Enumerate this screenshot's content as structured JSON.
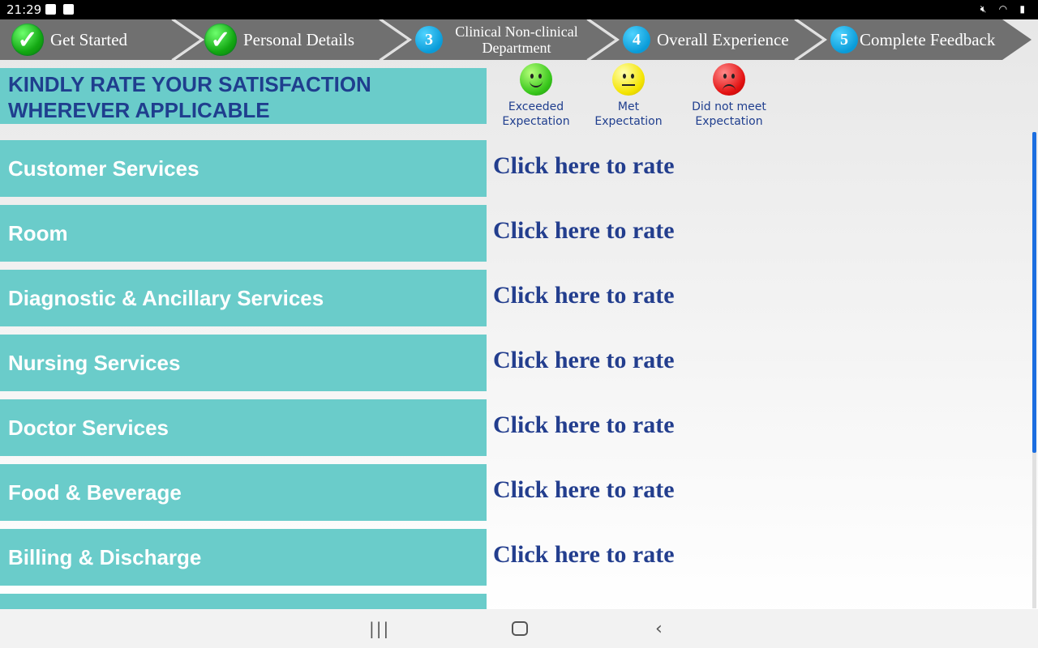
{
  "status_bar": {
    "time": "21:29",
    "right_icons": [
      "mute-icon",
      "wifi-icon",
      "battery-icon"
    ]
  },
  "steps": [
    {
      "marker": "check",
      "label": "Get Started",
      "completed": true
    },
    {
      "marker": "check",
      "label": "Personal Details",
      "completed": true
    },
    {
      "marker": "3",
      "label": "Clinical Non-clinical Department",
      "completed": false
    },
    {
      "marker": "4",
      "label": "Overall Experience",
      "completed": false
    },
    {
      "marker": "5",
      "label": "Complete Feedback",
      "completed": false
    }
  ],
  "instruction": "KINDLY RATE YOUR SATISFACTION WHEREVER APPLICABLE",
  "legend": [
    {
      "face": "green-smile-icon",
      "label": "Exceeded Expectation"
    },
    {
      "face": "yellow-neutral-icon",
      "label": "Met Expectation"
    },
    {
      "face": "red-frown-icon",
      "label": "Did not meet Expectation"
    }
  ],
  "rows": [
    {
      "category": "Customer Services",
      "action": "Click here to rate"
    },
    {
      "category": "Room",
      "action": "Click here to rate"
    },
    {
      "category": "Diagnostic & Ancillary Services",
      "action": "Click here to rate"
    },
    {
      "category": "Nursing Services",
      "action": "Click here to rate"
    },
    {
      "category": "Doctor Services",
      "action": "Click here to rate"
    },
    {
      "category": "Food & Beverage",
      "action": "Click here to rate"
    },
    {
      "category": "Billing & Discharge",
      "action": "Click here to rate"
    }
  ],
  "colors": {
    "row_bg": "#6accca",
    "title_text": "#1f3e8e",
    "step_bar": "#6e6e6e",
    "scroll_thumb": "#1c6ee0"
  },
  "nav": [
    "recent-apps-icon",
    "home-icon",
    "back-icon"
  ]
}
